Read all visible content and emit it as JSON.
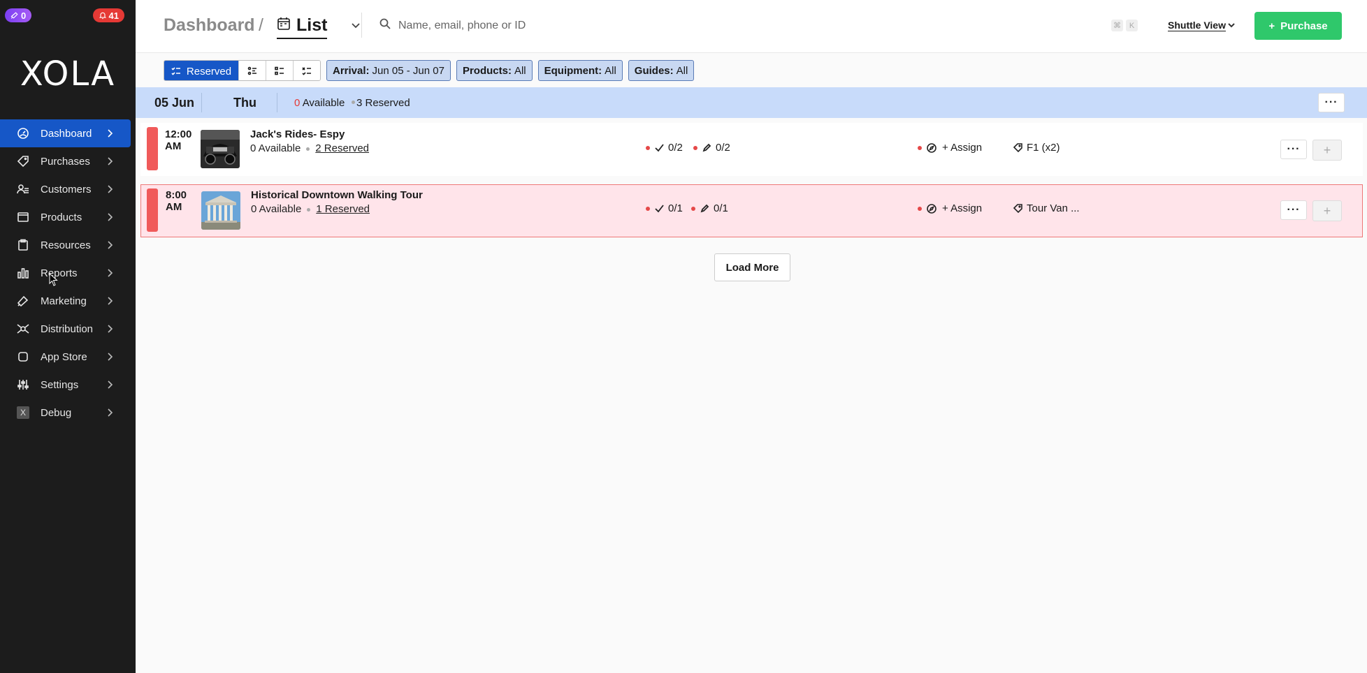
{
  "sidebar": {
    "badge_left": "0",
    "badge_right": "41",
    "logo": "XOLA",
    "items": [
      {
        "label": "Dashboard",
        "icon": "dashboard-icon",
        "active": true
      },
      {
        "label": "Purchases",
        "icon": "tag-icon"
      },
      {
        "label": "Customers",
        "icon": "users-icon"
      },
      {
        "label": "Products",
        "icon": "box-icon"
      },
      {
        "label": "Resources",
        "icon": "clipboard-icon"
      },
      {
        "label": "Reports",
        "icon": "bar-chart-icon"
      },
      {
        "label": "Marketing",
        "icon": "megaphone-icon"
      },
      {
        "label": "Distribution",
        "icon": "distribution-icon"
      },
      {
        "label": "App Store",
        "icon": "app-store-icon"
      },
      {
        "label": "Settings",
        "icon": "sliders-icon"
      },
      {
        "label": "Debug",
        "icon": "debug-icon",
        "icon_text": "X"
      }
    ]
  },
  "header": {
    "breadcrumb": "Dashboard",
    "separator": "/",
    "view_label": "List",
    "search_placeholder": "Name, email, phone or ID",
    "kbd_cmd": "⌘",
    "kbd_k": "K",
    "shuttle_view": "Shuttle View",
    "purchase_label": "Purchase"
  },
  "filters": {
    "reserved_label": "Reserved",
    "chips": [
      {
        "key": "Arrival:",
        "value": "Jun 05 - Jun 07"
      },
      {
        "key": "Products:",
        "value": "All"
      },
      {
        "key": "Equipment:",
        "value": "All"
      },
      {
        "key": "Guides:",
        "value": "All"
      }
    ]
  },
  "day": {
    "date": "05 Jun",
    "dow": "Thu",
    "available_num": "0",
    "available_label": "Available",
    "reserved": "3 Reserved"
  },
  "events": [
    {
      "time_line1": "12:00",
      "time_line2": "AM",
      "title": "Jack's Rides- Espy",
      "available": "0 Available",
      "reserved": "2 Reserved",
      "checked_in": "0/2",
      "waivers": "0/2",
      "assign": "+ Assign",
      "equipment": "F1 (x2)"
    },
    {
      "time_line1": "8:00",
      "time_line2": "AM",
      "title": "Historical Downtown Walking Tour",
      "available": "0 Available",
      "reserved": "1 Reserved",
      "checked_in": "0/1",
      "waivers": "0/1",
      "assign": "+ Assign",
      "equipment": "Tour Van ..."
    }
  ],
  "load_more": "Load More",
  "colors": {
    "sidebar_bg": "#1c1c1c",
    "active_blue": "#1657c7",
    "purchase_green": "#2fc86b",
    "day_row_bg": "#c8dbfa",
    "status_red": "#f05a5a"
  }
}
